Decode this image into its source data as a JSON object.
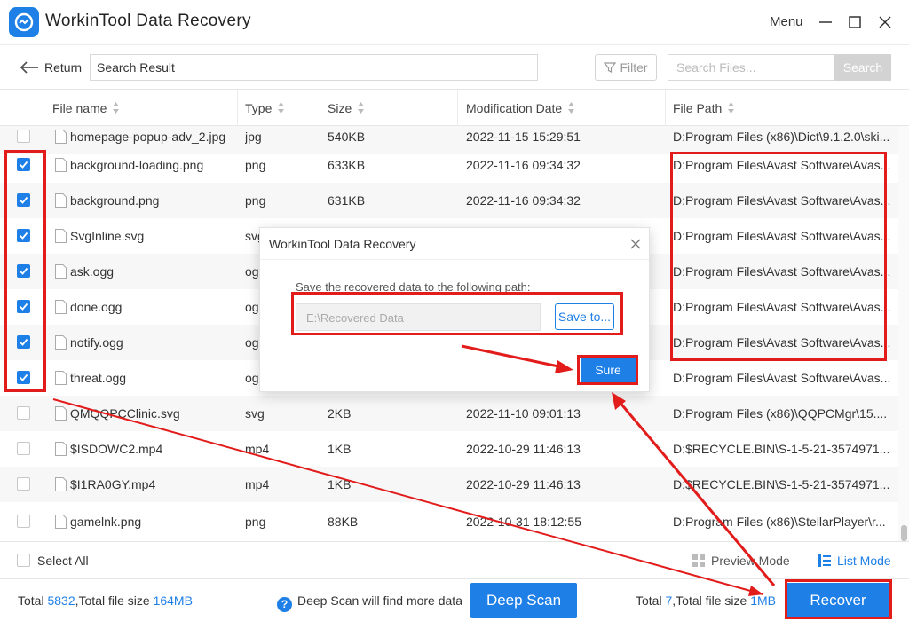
{
  "app": {
    "title": "WorkinTool Data Recovery",
    "menu_label": "Menu"
  },
  "toolbar": {
    "return_label": "Return",
    "search_result_label": "Search Result",
    "filter_label": "Filter",
    "search_placeholder": "Search Files...",
    "search_button": "Search"
  },
  "table": {
    "columns": [
      "File name",
      "Type",
      "Size",
      "Modification Date",
      "File Path"
    ],
    "rows": [
      {
        "name": "homepage-popup-adv_2.jpg",
        "type": "jpg",
        "size": "540KB",
        "date": "2022-11-15 15:29:51",
        "path": "D:Program Files (x86)\\Dict\\9.1.2.0\\ski...",
        "checked": false
      },
      {
        "name": "background-loading.png",
        "type": "png",
        "size": "633KB",
        "date": "2022-11-16 09:34:32",
        "path": "D:Program Files\\Avast Software\\Avas...",
        "checked": true
      },
      {
        "name": "background.png",
        "type": "png",
        "size": "631KB",
        "date": "2022-11-16 09:34:32",
        "path": "D:Program Files\\Avast Software\\Avas...",
        "checked": true
      },
      {
        "name": "SvgInline.svg",
        "type": "svg",
        "size": "",
        "date": "",
        "path": "D:Program Files\\Avast Software\\Avas...",
        "checked": true
      },
      {
        "name": "ask.ogg",
        "type": "ogg",
        "size": "",
        "date": "",
        "path": "D:Program Files\\Avast Software\\Avas...",
        "checked": true
      },
      {
        "name": "done.ogg",
        "type": "ogg",
        "size": "",
        "date": "",
        "path": "D:Program Files\\Avast Software\\Avas...",
        "checked": true
      },
      {
        "name": "notify.ogg",
        "type": "ogg",
        "size": "",
        "date": "",
        "path": "D:Program Files\\Avast Software\\Avas...",
        "checked": true
      },
      {
        "name": "threat.ogg",
        "type": "ogg",
        "size": "",
        "date": "",
        "path": "D:Program Files\\Avast Software\\Avas...",
        "checked": true
      },
      {
        "name": "QMQQPCClinic.svg",
        "type": "svg",
        "size": "2KB",
        "date": "2022-11-10 09:01:13",
        "path": "D:Program Files (x86)\\QQPCMgr\\15....",
        "checked": false
      },
      {
        "name": "$ISDOWC2.mp4",
        "type": "mp4",
        "size": "1KB",
        "date": "2022-10-29 11:46:13",
        "path": "D:$RECYCLE.BIN\\S-1-5-21-3574971...",
        "checked": false
      },
      {
        "name": "$I1RA0GY.mp4",
        "type": "mp4",
        "size": "1KB",
        "date": "2022-10-29 11:46:13",
        "path": "D:$RECYCLE.BIN\\S-1-5-21-3574971...",
        "checked": false
      },
      {
        "name": "gamelnk.png",
        "type": "png",
        "size": "88KB",
        "date": "2022-10-31 18:12:55",
        "path": "D:Program Files (x86)\\StellarPlayer\\r...",
        "checked": false
      }
    ]
  },
  "footer": {
    "select_all": "Select All",
    "preview_mode": "Preview Mode",
    "list_mode": "List Mode",
    "total_prefix": "Total ",
    "total_count": "5832",
    "total_size_prefix": ",Total file size ",
    "total_size": "164MB",
    "deep_scan_hint": "Deep Scan will find more data",
    "deep_scan_button": "Deep Scan",
    "selected_prefix": "Total ",
    "selected_count": "7",
    "selected_size_prefix": ",Total file size ",
    "selected_size": "1MB",
    "recover_button": "Recover"
  },
  "dialog": {
    "title": "WorkinTool Data Recovery",
    "message": "Save the recovered data to the following path:",
    "path_value": "E:\\Recovered Data",
    "save_to": "Save to...",
    "sure": "Sure"
  },
  "colors": {
    "accent": "#1e7fe6",
    "annotation": "#e21b1b"
  }
}
